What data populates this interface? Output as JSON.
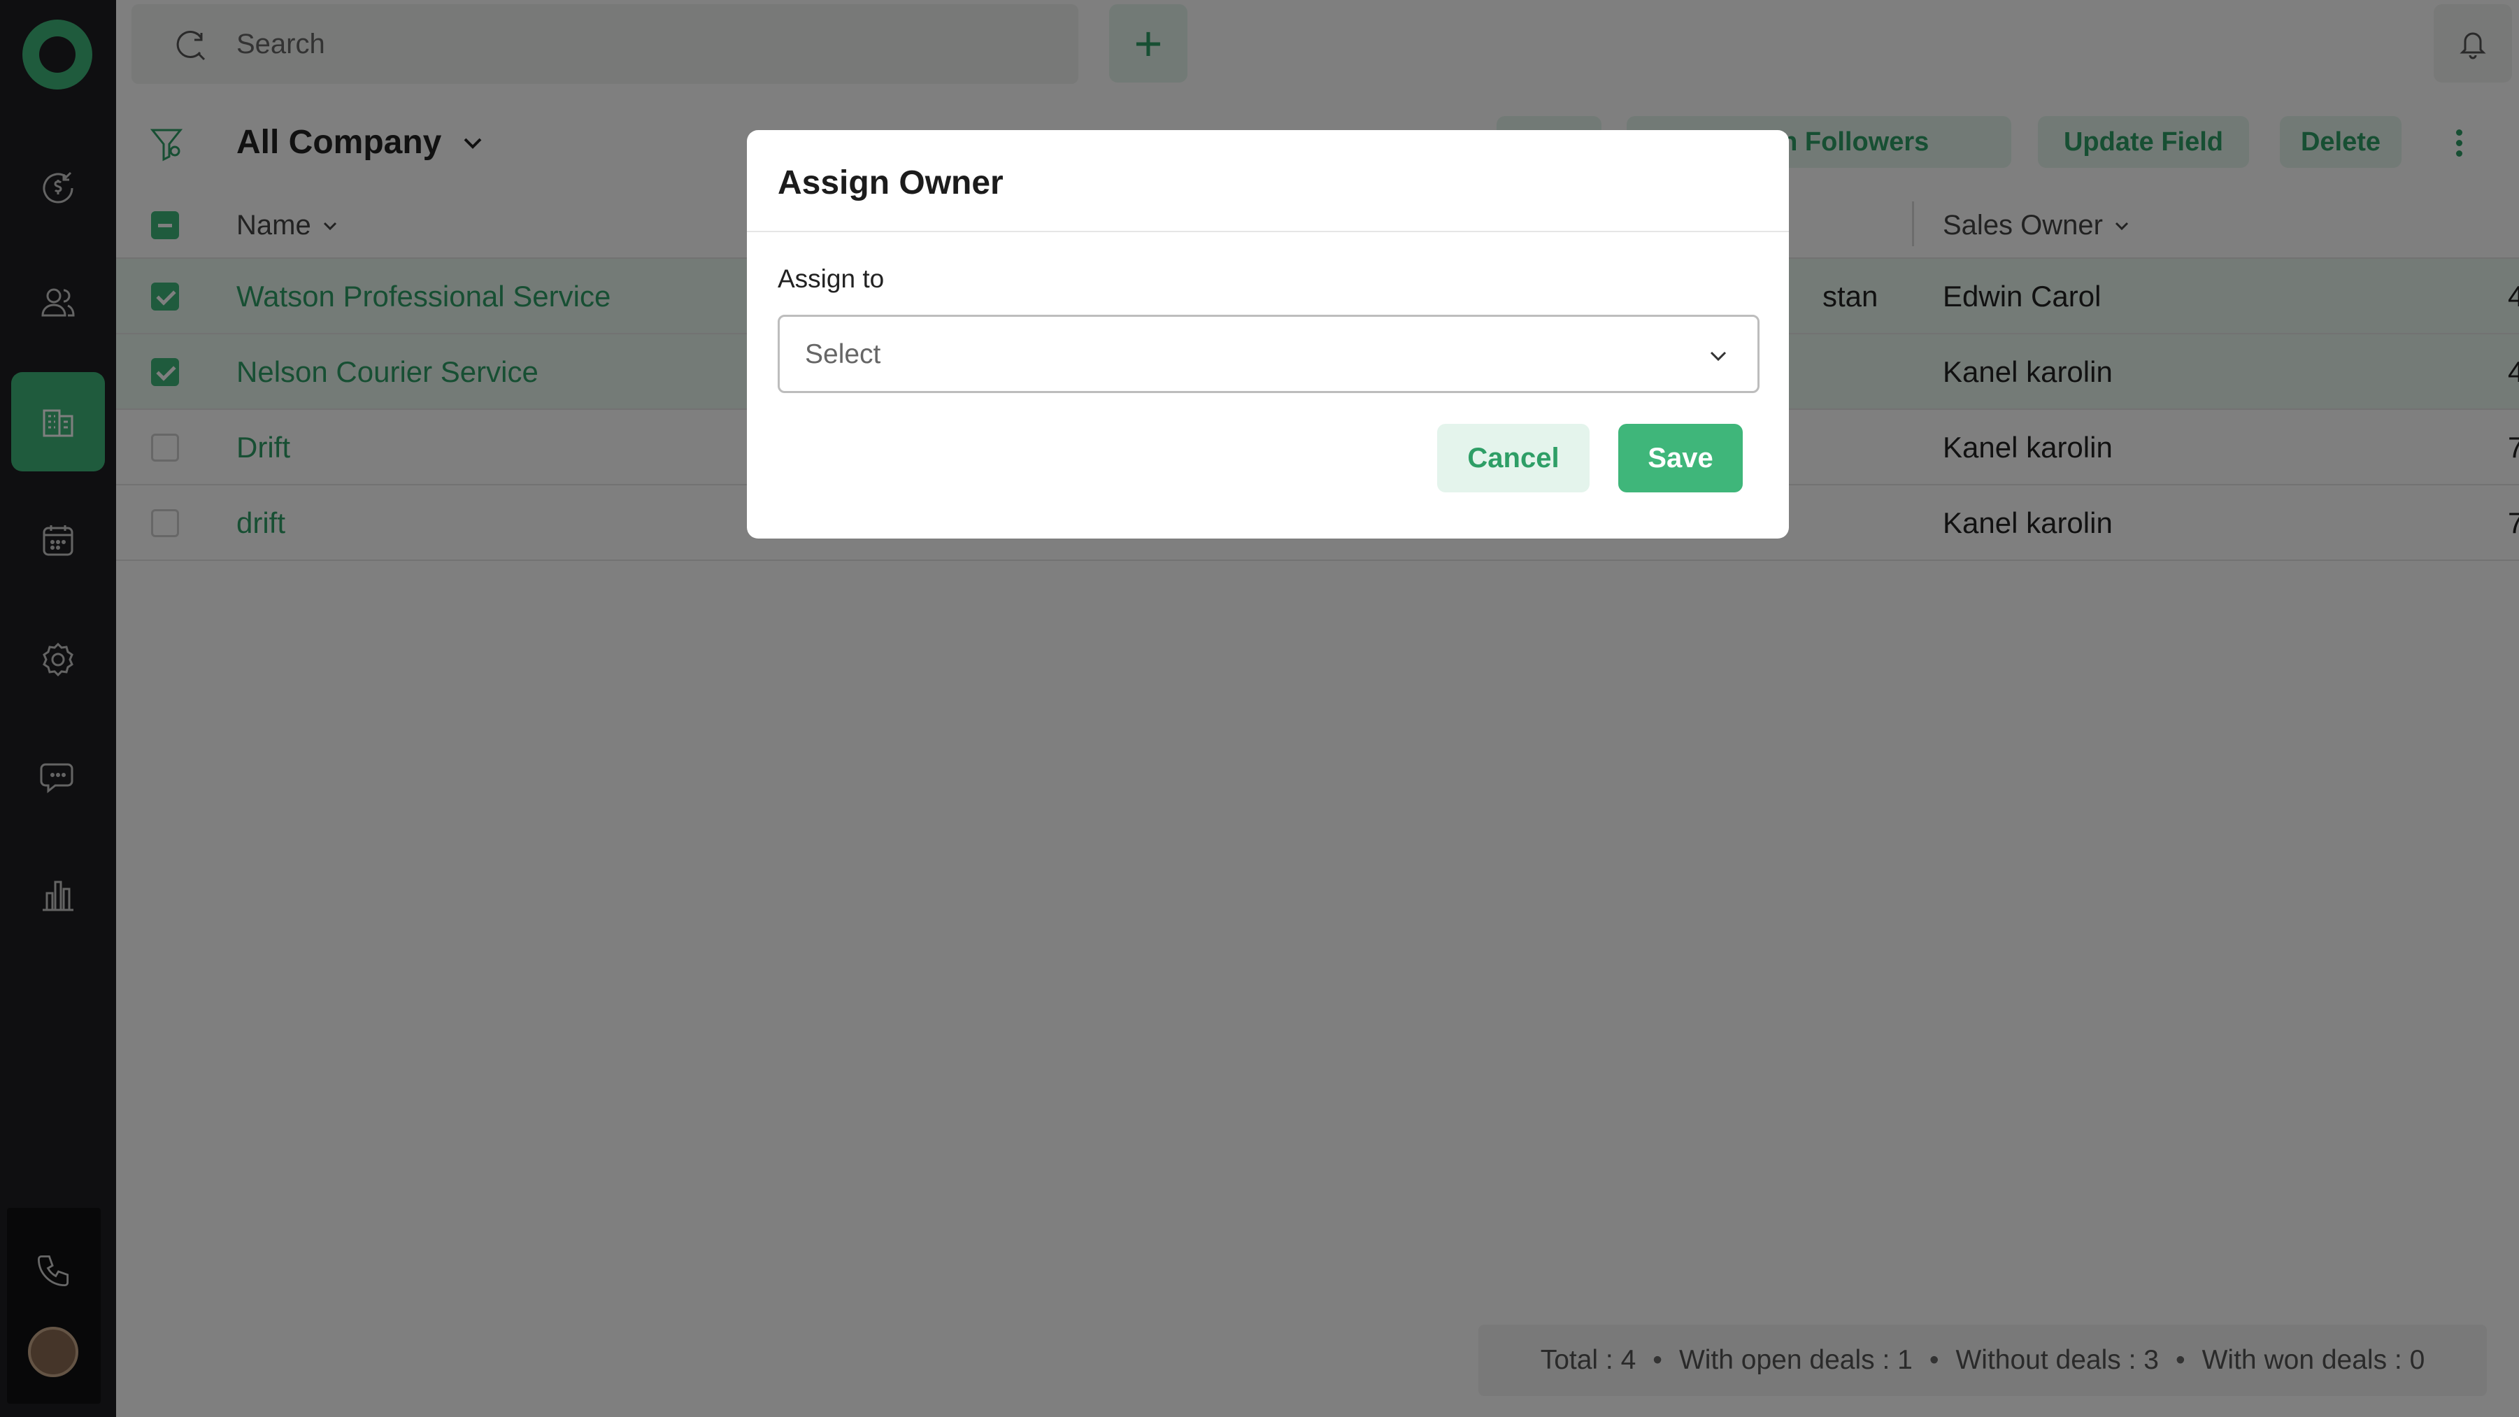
{
  "search": {
    "placeholder": "Search"
  },
  "toolbar": {
    "view_title": "All Company",
    "assign_followers_label": "Assign Followers",
    "update_field_label": "Update Field",
    "delete_label": "Delete"
  },
  "table": {
    "columns": {
      "name": "Name",
      "sales_owner": "Sales Owner"
    },
    "rows": [
      {
        "name": "Watson Professional Service",
        "region": "stan",
        "sales_owner": "Edwin Carol",
        "edge": "4",
        "selected": true
      },
      {
        "name": "Nelson Courier Service",
        "region": "",
        "sales_owner": "Kanel karolin",
        "edge": "4",
        "selected": true
      },
      {
        "name": "Drift",
        "region": "",
        "sales_owner": "Kanel karolin",
        "edge": "7",
        "selected": false
      },
      {
        "name": "drift",
        "region": "",
        "sales_owner": "Kanel karolin",
        "edge": "7",
        "selected": false
      }
    ]
  },
  "footer": {
    "total": "Total : 4",
    "open_deals": "With open deals : 1",
    "without_deals": "Without deals : 3",
    "won_deals": "With won deals : 0",
    "separator": "•"
  },
  "modal": {
    "title": "Assign Owner",
    "assign_to_label": "Assign to",
    "select_placeholder": "Select",
    "cancel_label": "Cancel",
    "save_label": "Save"
  },
  "colors": {
    "accent": "#3fb67a",
    "accent_text": "#2e9e66",
    "accent_light": "#e4f4ec",
    "sidebar": "#1f1f22"
  }
}
